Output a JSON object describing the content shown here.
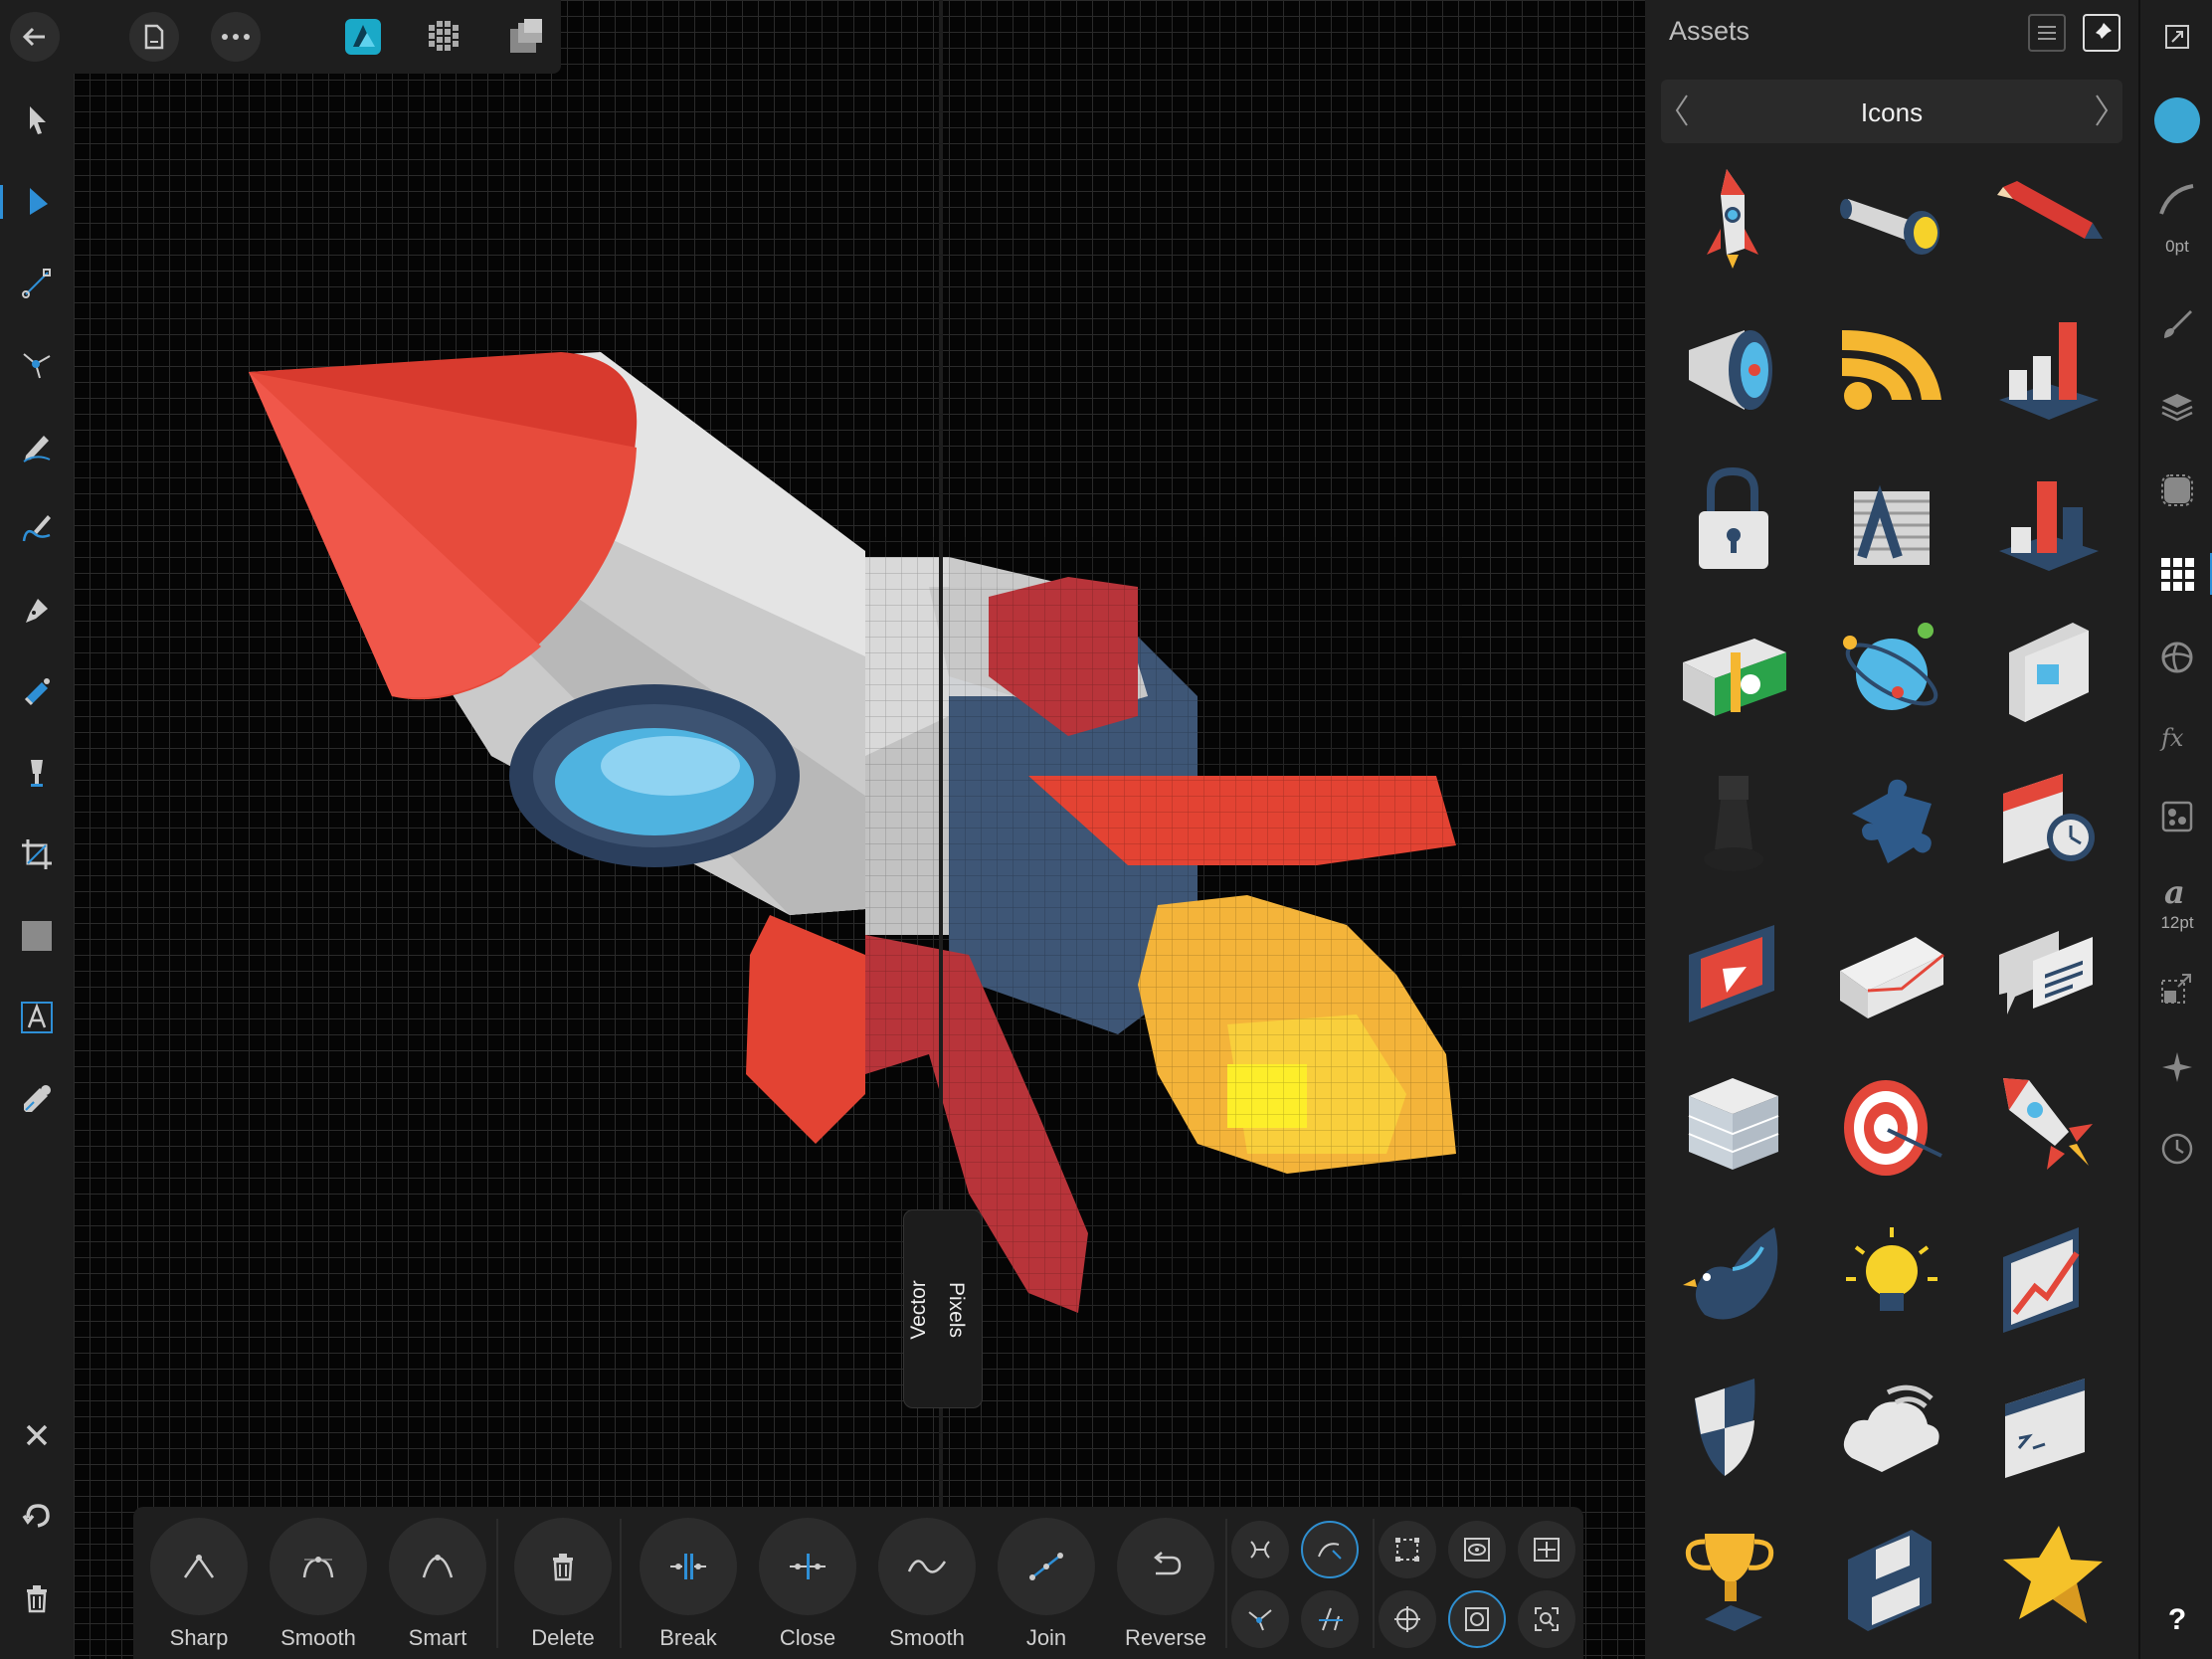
{
  "canvas": {
    "split_labels": {
      "left": "Vector",
      "right": "Pixels"
    }
  },
  "top_toolbar": {
    "icons": [
      "back-arrow-icon",
      "document-icon",
      "more-icon",
      "designer-persona-icon",
      "pixel-persona-icon",
      "export-persona-icon"
    ]
  },
  "tools": [
    "move-tool",
    "node-tool",
    "corner-tool",
    "point-transform-tool",
    "pencil-tool",
    "vector-brush-tool",
    "pen-tool",
    "fill-tool",
    "transparency-tool",
    "crop-tool",
    "shape-tool",
    "text-tool",
    "color-picker-tool"
  ],
  "bottom_left": [
    "close-icon",
    "undo-icon",
    "trash-icon"
  ],
  "assets": {
    "title": "Assets",
    "category": "Icons",
    "items": [
      "rocket",
      "flashlight",
      "pencil",
      "megaphone",
      "rss",
      "bar-chart",
      "padlock",
      "stacked-letter",
      "bar-chart-red",
      "money-stack",
      "globe-orbit",
      "document-image",
      "chess-pawn",
      "puzzle-piece",
      "calendar-clock",
      "video-play",
      "envelope",
      "chat-bubbles",
      "server",
      "target",
      "rocket-launch",
      "bird",
      "light-bulb",
      "growth-chart",
      "shield",
      "cloud-wifi",
      "terminal-window",
      "trophy",
      "floppy-disk",
      "star"
    ]
  },
  "studio": {
    "stroke_width": "0pt",
    "text_size": "12pt",
    "help": "?",
    "accent_color": "#3ba7d4"
  },
  "node_toolbar": {
    "buttons": [
      {
        "label": "Sharp"
      },
      {
        "label": "Smooth"
      },
      {
        "label": "Smart"
      },
      {
        "label": "Delete"
      },
      {
        "label": "Break"
      },
      {
        "label": "Close"
      },
      {
        "label": "Smooth"
      },
      {
        "label": "Join"
      },
      {
        "label": "Reverse"
      }
    ]
  }
}
